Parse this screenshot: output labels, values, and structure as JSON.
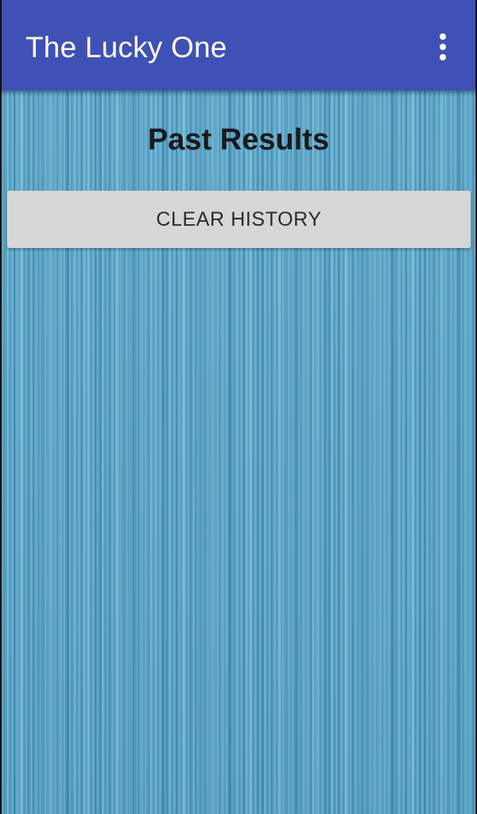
{
  "app_bar": {
    "title": "The Lucky One",
    "background_color": "#3f51b5",
    "overflow_icon": "more-vert-icon"
  },
  "main": {
    "heading": "Past Results",
    "clear_button_label": "CLEAR HISTORY",
    "background_texture": "blue wood grain",
    "background_color": "#5aa6c8"
  }
}
